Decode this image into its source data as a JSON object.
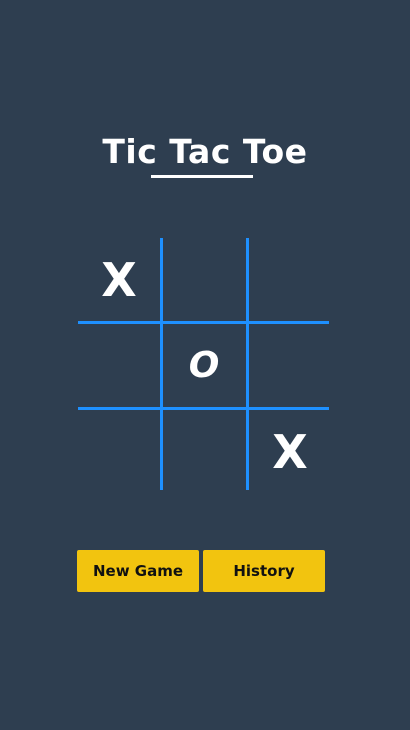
{
  "title": "Tic Tac Toe",
  "board": {
    "cells": [
      "X",
      "",
      "",
      "",
      "O",
      "",
      "",
      "",
      "X"
    ]
  },
  "buttons": {
    "new_game": "New Game",
    "history": "History"
  },
  "colors": {
    "background": "#2e3e50",
    "grid": "#1e90ff",
    "button": "#f2c40f",
    "text": "#ffffff"
  }
}
